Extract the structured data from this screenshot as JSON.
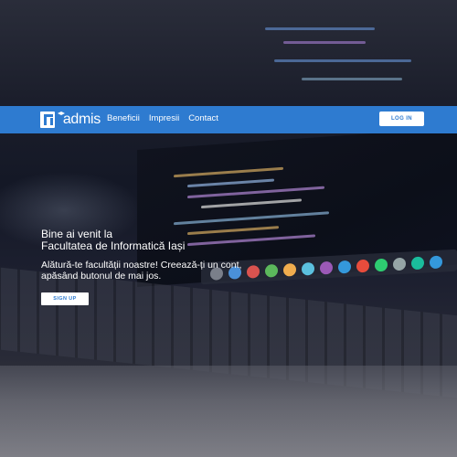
{
  "brand": {
    "name": "admis"
  },
  "nav": {
    "links": [
      {
        "label": "Beneficii"
      },
      {
        "label": "Impresii"
      },
      {
        "label": "Contact"
      }
    ],
    "login_label": "LOG IN"
  },
  "hero": {
    "title_line1": "Bine ai venit la",
    "title_line2": "Facultatea de Informatică Iași",
    "subtitle_line1": "Alătură-te facultății noastre! Creează-ți un cont,",
    "subtitle_line2": "apăsând butonul de mai jos.",
    "signup_label": "SIGN UP"
  },
  "colors": {
    "navbar": "#2e7bd0",
    "button_bg": "#ffffff",
    "button_text": "#2e7bd0"
  },
  "icons": {
    "logo": "logo-mark-icon"
  }
}
